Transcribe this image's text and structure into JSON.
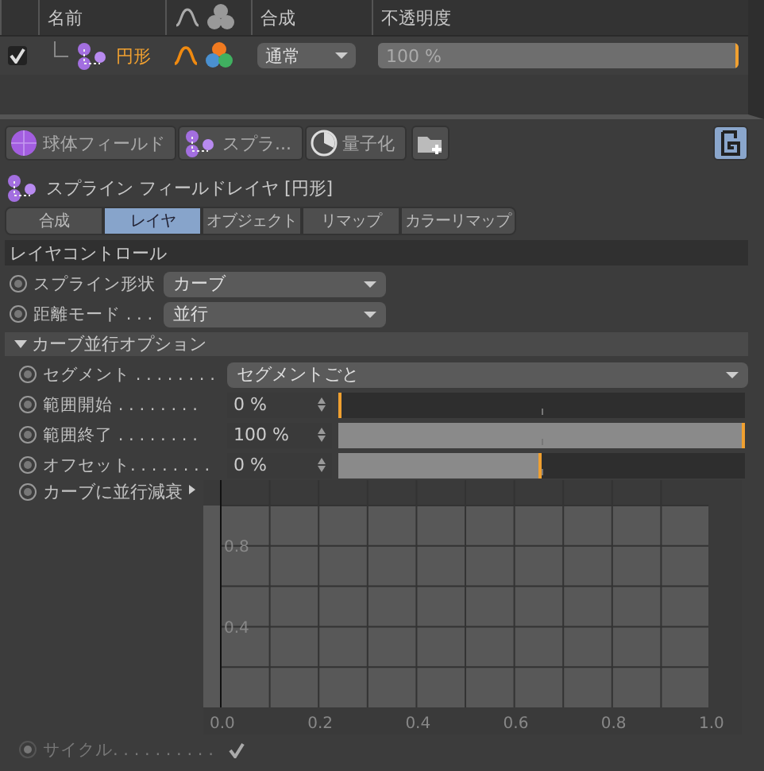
{
  "layers": {
    "columns": [
      {
        "label": "名前"
      },
      {
        "label": "合成"
      },
      {
        "label": "不透明度"
      }
    ],
    "rows": [
      {
        "enabled": true,
        "name": "円形",
        "blend": "通常",
        "opacity": "100 %",
        "level": 1
      }
    ]
  },
  "toolbar": {
    "buttons": [
      {
        "label": "球体フィールド",
        "kind": "sphere"
      },
      {
        "label": "スプラ...",
        "kind": "spline"
      },
      {
        "label": "量子化",
        "kind": "quantize"
      }
    ]
  },
  "panel_title": "スプライン フィールドレイヤ [円形]",
  "tabs": [
    {
      "label": "合成",
      "selected": false
    },
    {
      "label": "レイヤ",
      "selected": true
    },
    {
      "label": "オブジェクト",
      "selected": false
    },
    {
      "label": "リマップ",
      "selected": false
    },
    {
      "label": "カラーリマップ",
      "selected": false
    }
  ],
  "section": {
    "title": "レイヤコントロール",
    "rows": [
      {
        "kind": "dropdown",
        "label": "スプライン形状",
        "value": "カーブ"
      },
      {
        "kind": "dropdown",
        "label": "距離モード . . .",
        "value": "並行"
      }
    ]
  },
  "subsection": {
    "title": "カーブ並行オプション",
    "expanded": true,
    "rows": [
      {
        "kind": "dropdown",
        "label": "セグメント . . . . . . . .",
        "value": "セグメントごと"
      },
      {
        "kind": "slider",
        "label": "範囲開始 . . . . . . . .",
        "value": "0 %",
        "level": 0
      },
      {
        "kind": "slider",
        "label": "範囲終了 . . . . . . . .",
        "value": "100 %",
        "level": 1
      },
      {
        "kind": "slider",
        "label": "オフセット. . . . . . . .",
        "value": "0 %",
        "level": 0.5
      },
      {
        "kind": "graph",
        "label": "カーブに並行減衰",
        "xticks": [
          "0.0",
          "0.2",
          "0.4",
          "0.6",
          "0.8",
          "1.0"
        ],
        "yticks": [
          "0.8",
          "0.4"
        ]
      },
      {
        "kind": "checkbox",
        "label": "サイクル. . . . . . . . . .",
        "checked": true,
        "disabled": true
      }
    ]
  }
}
